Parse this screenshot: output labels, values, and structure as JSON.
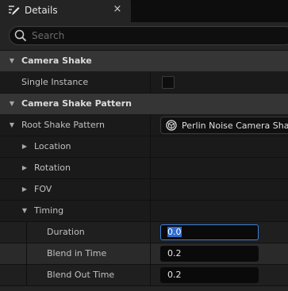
{
  "tab": {
    "title": "Details",
    "close_glyph": "×"
  },
  "search": {
    "placeholder": "Search",
    "value": ""
  },
  "categories": {
    "camera_shake": "Camera Shake",
    "camera_shake_pattern": "Camera Shake Pattern"
  },
  "properties": {
    "single_instance": {
      "label": "Single Instance",
      "checked": false
    },
    "root_shake_pattern": {
      "label": "Root Shake Pattern",
      "value": "Perlin Noise Camera Shake Pattern"
    },
    "location": "Location",
    "rotation": "Rotation",
    "fov": "FOV",
    "timing": "Timing",
    "duration": {
      "label": "Duration",
      "value": "0.0"
    },
    "blend_in_time": {
      "label": "Blend in Time",
      "value": "0.2"
    },
    "blend_out_time": {
      "label": "Blend Out Time",
      "value": "0.2"
    }
  },
  "colors": {
    "accent": "#3d7fd9",
    "selection": "#2f6bd1",
    "category_bg": "#353535",
    "panel_bg": "#242424"
  }
}
